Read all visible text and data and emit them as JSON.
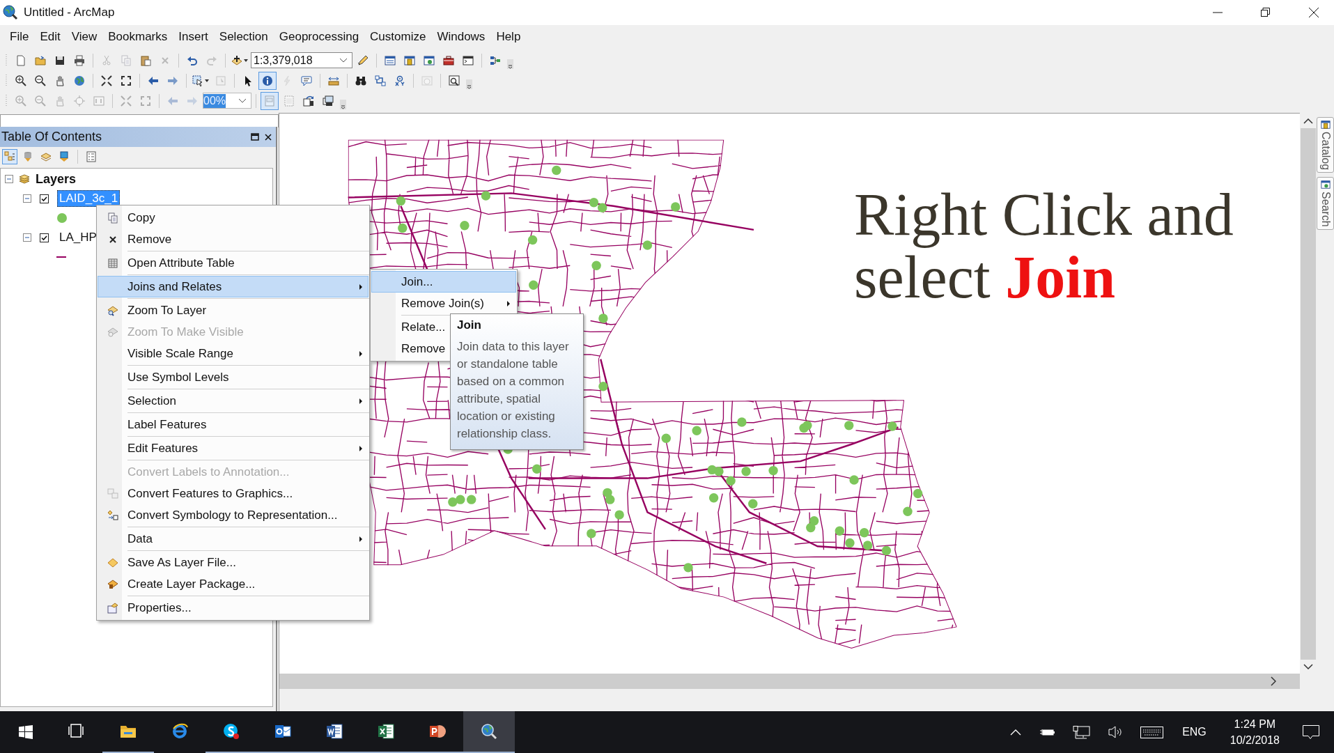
{
  "window": {
    "title": "Untitled - ArcMap"
  },
  "menu_bar": [
    {
      "label": "File"
    },
    {
      "label": "Edit"
    },
    {
      "label": "View"
    },
    {
      "label": "Bookmarks"
    },
    {
      "label": "Insert"
    },
    {
      "label": "Selection"
    },
    {
      "label": "Geoprocessing"
    },
    {
      "label": "Customize"
    },
    {
      "label": "Windows"
    },
    {
      "label": "Help"
    }
  ],
  "toolbars": [
    {
      "items": [
        {
          "kind": "button",
          "disabled": false,
          "selected": false
        },
        {
          "kind": "button",
          "disabled": false,
          "selected": false
        },
        {
          "kind": "button",
          "disabled": false,
          "selected": false
        },
        {
          "kind": "button",
          "disabled": false,
          "selected": false
        },
        {
          "kind": "separator"
        },
        {
          "kind": "button",
          "disabled": true,
          "selected": false
        },
        {
          "kind": "button",
          "disabled": true,
          "selected": false
        },
        {
          "kind": "button",
          "disabled": false,
          "selected": false
        },
        {
          "kind": "button",
          "disabled": true,
          "selected": false
        },
        {
          "kind": "separator"
        },
        {
          "kind": "button",
          "disabled": false,
          "selected": false
        },
        {
          "kind": "button",
          "disabled": true,
          "selected": false
        },
        {
          "kind": "separator"
        },
        {
          "kind": "button",
          "disabled": false,
          "selected": false
        },
        {
          "kind": "combo",
          "value": "1:3,379,018",
          "highlighted": false
        },
        {
          "kind": "button",
          "disabled": false,
          "selected": false
        },
        {
          "kind": "separator"
        },
        {
          "kind": "button",
          "disabled": false,
          "selected": false
        },
        {
          "kind": "button",
          "disabled": false,
          "selected": false
        },
        {
          "kind": "button",
          "disabled": false,
          "selected": false
        },
        {
          "kind": "button",
          "disabled": false,
          "selected": false
        },
        {
          "kind": "button",
          "disabled": false,
          "selected": false
        },
        {
          "kind": "separator"
        },
        {
          "kind": "button",
          "disabled": false,
          "selected": false
        }
      ]
    },
    {
      "items": [
        {
          "kind": "button",
          "disabled": false,
          "selected": false
        },
        {
          "kind": "button",
          "disabled": false,
          "selected": false
        },
        {
          "kind": "button",
          "disabled": false,
          "selected": false
        },
        {
          "kind": "button",
          "disabled": false,
          "selected": false
        },
        {
          "kind": "separator"
        },
        {
          "kind": "button",
          "disabled": false,
          "selected": false
        },
        {
          "kind": "button",
          "disabled": false,
          "selected": false
        },
        {
          "kind": "separator"
        },
        {
          "kind": "button",
          "disabled": false,
          "selected": false
        },
        {
          "kind": "button",
          "disabled": false,
          "selected": false
        },
        {
          "kind": "separator"
        },
        {
          "kind": "button",
          "disabled": false,
          "selected": false
        },
        {
          "kind": "button",
          "disabled": true,
          "selected": false
        },
        {
          "kind": "separator"
        },
        {
          "kind": "button",
          "disabled": false,
          "selected": false
        },
        {
          "kind": "button",
          "disabled": false,
          "selected": true
        },
        {
          "kind": "button",
          "disabled": true,
          "selected": false
        },
        {
          "kind": "button",
          "disabled": false,
          "selected": false
        },
        {
          "kind": "separator"
        },
        {
          "kind": "button",
          "disabled": false,
          "selected": false
        },
        {
          "kind": "separator"
        },
        {
          "kind": "button",
          "disabled": false,
          "selected": false
        },
        {
          "kind": "button",
          "disabled": false,
          "selected": false
        },
        {
          "kind": "button",
          "disabled": false,
          "selected": false
        },
        {
          "kind": "separator"
        },
        {
          "kind": "button",
          "disabled": true,
          "selected": false
        },
        {
          "kind": "separator"
        },
        {
          "kind": "button",
          "disabled": false,
          "selected": false
        }
      ]
    },
    {
      "items": [
        {
          "kind": "button",
          "disabled": true,
          "selected": false
        },
        {
          "kind": "button",
          "disabled": true,
          "selected": false
        },
        {
          "kind": "button",
          "disabled": true,
          "selected": false
        },
        {
          "kind": "button",
          "disabled": true,
          "selected": false
        },
        {
          "kind": "button",
          "disabled": true,
          "selected": false
        },
        {
          "kind": "separator"
        },
        {
          "kind": "button",
          "disabled": true,
          "selected": false
        },
        {
          "kind": "button",
          "disabled": true,
          "selected": false
        },
        {
          "kind": "separator"
        },
        {
          "kind": "button",
          "disabled": true,
          "selected": false
        },
        {
          "kind": "button",
          "disabled": true,
          "selected": false
        },
        {
          "kind": "combo",
          "value": "00%",
          "highlighted": true
        },
        {
          "kind": "separator"
        },
        {
          "kind": "button",
          "disabled": true,
          "selected": true
        },
        {
          "kind": "button",
          "disabled": true,
          "selected": false
        },
        {
          "kind": "button",
          "disabled": false,
          "selected": false
        },
        {
          "kind": "button",
          "disabled": false,
          "selected": false
        }
      ]
    }
  ],
  "table_of_contents": {
    "title": "Table Of Contents",
    "tools": [
      {
        "selected": true
      },
      {
        "selected": false
      },
      {
        "selected": false
      },
      {
        "selected": false
      },
      {
        "selected": false
      }
    ],
    "root": {
      "label": "Layers",
      "expanded": true,
      "children": [
        {
          "label": "LAID_3c_1",
          "checked": true,
          "selected": true,
          "expanded": true,
          "legend": {
            "kind": "point",
            "color": "#7dc65b"
          }
        },
        {
          "label": "LA_HP",
          "checked": true,
          "selected": false,
          "expanded": true,
          "legend": {
            "kind": "line",
            "color": "#960060"
          }
        }
      ]
    }
  },
  "context_menu": {
    "items": [
      {
        "kind": "item",
        "label": "Copy",
        "disabled": false,
        "submenu": false,
        "selected": false
      },
      {
        "kind": "item",
        "label": "Remove",
        "disabled": false,
        "submenu": false,
        "selected": false
      },
      {
        "kind": "separator"
      },
      {
        "kind": "item",
        "label": "Open Attribute Table",
        "disabled": false,
        "submenu": false,
        "selected": false
      },
      {
        "kind": "separator"
      },
      {
        "kind": "item",
        "label": "Joins and Relates",
        "disabled": false,
        "submenu": true,
        "selected": true
      },
      {
        "kind": "separator"
      },
      {
        "kind": "item",
        "label": "Zoom To Layer",
        "disabled": false,
        "submenu": false,
        "selected": false
      },
      {
        "kind": "item",
        "label": "Zoom To Make Visible",
        "disabled": true,
        "submenu": false,
        "selected": false
      },
      {
        "kind": "item",
        "label": "Visible Scale Range",
        "disabled": false,
        "submenu": true,
        "selected": false
      },
      {
        "kind": "separator"
      },
      {
        "kind": "item",
        "label": "Use Symbol Levels",
        "disabled": false,
        "submenu": false,
        "selected": false
      },
      {
        "kind": "separator"
      },
      {
        "kind": "item",
        "label": "Selection",
        "disabled": false,
        "submenu": true,
        "selected": false
      },
      {
        "kind": "separator"
      },
      {
        "kind": "item",
        "label": "Label Features",
        "disabled": false,
        "submenu": false,
        "selected": false
      },
      {
        "kind": "separator"
      },
      {
        "kind": "item",
        "label": "Edit Features",
        "disabled": false,
        "submenu": true,
        "selected": false
      },
      {
        "kind": "separator"
      },
      {
        "kind": "item",
        "label": "Convert Labels to Annotation...",
        "disabled": true,
        "submenu": false,
        "selected": false
      },
      {
        "kind": "item",
        "label": "Convert Features to Graphics...",
        "disabled": false,
        "submenu": false,
        "selected": false
      },
      {
        "kind": "item",
        "label": "Convert Symbology to Representation...",
        "disabled": false,
        "submenu": false,
        "selected": false
      },
      {
        "kind": "separator"
      },
      {
        "kind": "item",
        "label": "Data",
        "disabled": false,
        "submenu": true,
        "selected": false
      },
      {
        "kind": "separator"
      },
      {
        "kind": "item",
        "label": "Save As Layer File...",
        "disabled": false,
        "submenu": false,
        "selected": false
      },
      {
        "kind": "item",
        "label": "Create Layer Package...",
        "disabled": false,
        "submenu": false,
        "selected": false
      },
      {
        "kind": "separator"
      },
      {
        "kind": "item",
        "label": "Properties...",
        "disabled": false,
        "submenu": false,
        "selected": false
      }
    ]
  },
  "submenu": {
    "items": [
      {
        "kind": "item",
        "label": "Join...",
        "submenu": false,
        "selected": true
      },
      {
        "kind": "item",
        "label": "Remove Join(s)",
        "submenu": true,
        "selected": false
      },
      {
        "kind": "separator"
      },
      {
        "kind": "item",
        "label": "Relate...",
        "selected": false
      },
      {
        "kind": "item",
        "label": "Remove",
        "selected": false
      }
    ]
  },
  "tooltip": {
    "title": "Join",
    "text": "Join data to this layer or standalone table based on a common attribute, spatial location or existing relationship class."
  },
  "map": {
    "caption": "Right Click and select **Join**"
  },
  "side_tabs": [
    {
      "label": "Catalog"
    },
    {
      "label": "Search"
    }
  ],
  "taskbar": {
    "apps": [
      {
        "running": false,
        "selected": false
      },
      {
        "running": true,
        "selected": false
      },
      {
        "running": false,
        "selected": false
      },
      {
        "running": true,
        "selected": false
      },
      {
        "running": true,
        "selected": false
      },
      {
        "running": true,
        "selected": false
      },
      {
        "running": true,
        "selected": false
      },
      {
        "running": true,
        "selected": false
      },
      {
        "running": true,
        "selected": true
      }
    ],
    "language": "ENG",
    "time": "1:24 PM",
    "date": "10/2/2018"
  }
}
